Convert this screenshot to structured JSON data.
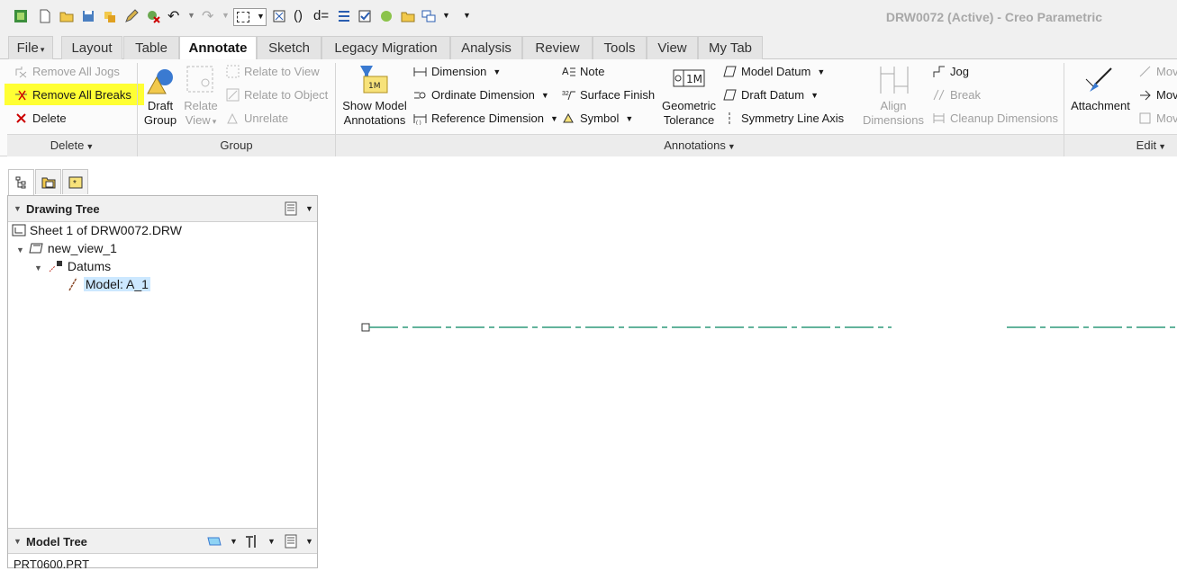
{
  "window": {
    "title": "DRW0072 (Active) - Creo Parametric"
  },
  "tabs": [
    {
      "label": "File"
    },
    {
      "label": "Layout"
    },
    {
      "label": "Table"
    },
    {
      "label": "Annotate"
    },
    {
      "label": "Sketch"
    },
    {
      "label": "Legacy Migration"
    },
    {
      "label": "Analysis"
    },
    {
      "label": "Review"
    },
    {
      "label": "Tools"
    },
    {
      "label": "View"
    },
    {
      "label": "My Tab"
    }
  ],
  "ribbon": {
    "delete_group": {
      "remove_all_jogs": "Remove All Jogs",
      "remove_all_breaks": "Remove All Breaks",
      "delete": "Delete",
      "label": "Delete"
    },
    "group_group": {
      "draft_group_line1": "Draft",
      "draft_group_line2": "Group",
      "relate_view_line1": "Relate",
      "relate_view_line2": "View",
      "relate_to_view": "Relate to View",
      "relate_to_object": "Relate to Object",
      "unrelate": "Unrelate",
      "label": "Group"
    },
    "annotations_group": {
      "show_model_line1": "Show Model",
      "show_model_line2": "Annotations",
      "dimension": "Dimension",
      "ordinate_dimension": "Ordinate Dimension",
      "reference_dimension": "Reference Dimension",
      "note": "Note",
      "surface_finish": "Surface Finish",
      "symbol": "Symbol",
      "geometric_line1": "Geometric",
      "geometric_line2": "Tolerance",
      "model_datum": "Model Datum",
      "draft_datum": "Draft Datum",
      "symmetry_line_axis": "Symmetry Line Axis",
      "align_line1": "Align",
      "align_line2": "Dimensions",
      "jog": "Jog",
      "break": "Break",
      "cleanup_dimensions": "Cleanup Dimensions",
      "label": "Annotations"
    },
    "edit_group": {
      "attachment": "Attachment",
      "move1": "Mov",
      "move2": "Mov",
      "move3": "Mov",
      "label": "Edit"
    },
    "highlight_color": "#ffff33"
  },
  "drawing_tree": {
    "header": "Drawing Tree",
    "items": [
      {
        "label": "Sheet 1 of DRW0072.DRW"
      },
      {
        "label": "new_view_1"
      },
      {
        "label": "Datums"
      },
      {
        "label": "Model: A_1"
      }
    ]
  },
  "model_tree": {
    "header": "Model Tree",
    "first_item": "PRT0600.PRT"
  },
  "colors": {
    "axis_line": "#2f9a7a",
    "selection": "#cce8ff"
  }
}
